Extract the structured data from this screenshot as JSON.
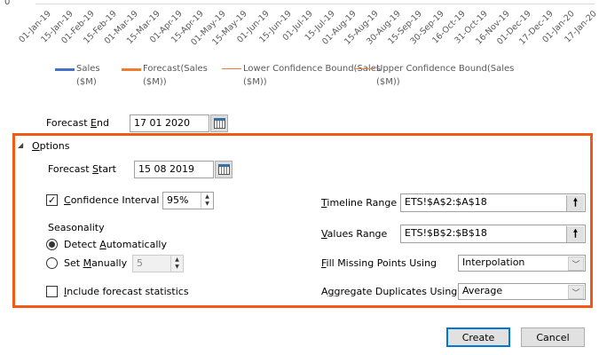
{
  "chart": {
    "y_tick": "0",
    "x_ticks": [
      "01-Jan-19",
      "15-Jan-19",
      "01-Feb-19",
      "15-Feb-19",
      "01-Mar-19",
      "15-Mar-19",
      "01-Apr-19",
      "15-Apr-19",
      "01-May-19",
      "15-May-19",
      "01-Jun-19",
      "15-Jun-19",
      "01-Jul-19",
      "15-Jul-19",
      "01-Aug-19",
      "15-Aug-19",
      "30-Aug-19",
      "15-Sep-19",
      "30-Sep-19",
      "16-Oct-19",
      "31-Oct-19",
      "16-Nov-19",
      "01-Dec-19",
      "17-Dec-19",
      "01-Jan-20",
      "17-Jan-20"
    ],
    "legend": [
      {
        "l1": "Sales",
        "l2": "($M)",
        "color": "#4472c4"
      },
      {
        "l1": "Forecast(Sales",
        "l2": "($M))",
        "color": "#ed7d31"
      },
      {
        "l1": "Lower Confidence Bound(Sales",
        "l2": "($M))",
        "color": "#ed7d31"
      },
      {
        "l1": "Upper Confidence Bound(Sales",
        "l2": "($M))",
        "color": "#ed7d31"
      }
    ]
  },
  "forecast_end": {
    "label_pre": "Forecast ",
    "label_key": "E",
    "label_post": "nd",
    "value": "17 01 2020"
  },
  "options": {
    "label_key": "O",
    "label_post": "ptions",
    "forecast_start": {
      "label_pre": "Forecast ",
      "label_key": "S",
      "label_post": "tart",
      "value": "15 08 2019"
    },
    "confidence": {
      "label_key": "C",
      "label_post": "onfidence Interval",
      "value": "95%",
      "checked": true
    },
    "seasonality": {
      "label": "Seasonality",
      "detect_pre": "Detect ",
      "detect_key": "A",
      "detect_post": "utomatically",
      "manual_pre": "Set ",
      "manual_key": "M",
      "manual_post": "anually",
      "manual_value": "5"
    },
    "stats": {
      "label_key": "I",
      "label_post": "nclude forecast statistics",
      "checked": false
    },
    "timeline": {
      "label_key": "T",
      "label_post": "imeline Range",
      "value": "ETS!$A$2:$A$18"
    },
    "values": {
      "label_key": "V",
      "label_post": "alues Range",
      "value": "ETS!$B$2:$B$18"
    },
    "fill": {
      "label_key": "F",
      "label_post": "ill Missing Points Using",
      "value": "Interpolation"
    },
    "aggregate": {
      "label_pre": "A",
      "label_key": "g",
      "label_post": "gregate Duplicates Using",
      "value": "Average"
    }
  },
  "buttons": {
    "create": "Create",
    "cancel": "Cancel"
  },
  "accent": "#f05a16"
}
